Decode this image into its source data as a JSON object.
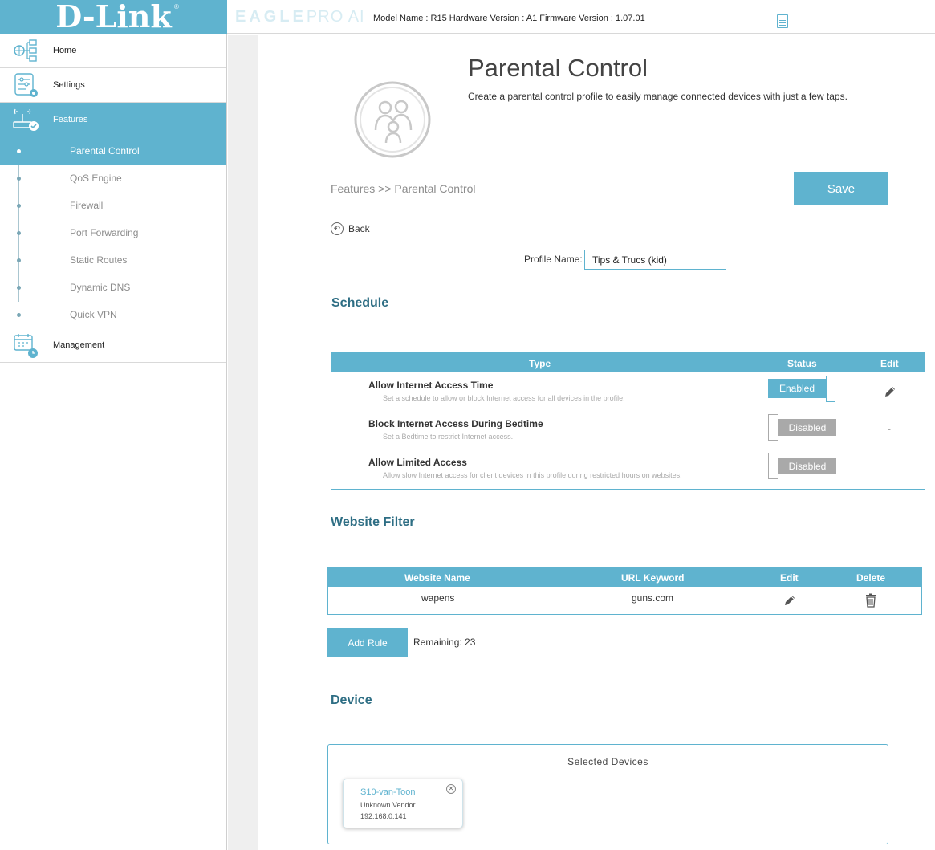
{
  "header": {
    "logo": "D-Link",
    "logo_mark": "®",
    "brand_bold": "EAGLE",
    "brand_light": "PRO AI",
    "model_info": "Model Name : R15 Hardware Version : A1 Firmware Version : 1.07.01",
    "icon": "document-icon"
  },
  "sidebar": {
    "home": "Home",
    "settings": "Settings",
    "features": "Features",
    "management": "Management",
    "sub_items": [
      "Parental Control",
      "QoS Engine",
      "Firewall",
      "Port Forwarding",
      "Static Routes",
      "Dynamic DNS",
      "Quick VPN"
    ]
  },
  "page": {
    "title": "Parental Control",
    "description": "Create a parental control profile to easily manage connected devices with just a few taps.",
    "breadcrumb": "Features >> Parental Control",
    "save": "Save",
    "back": "Back",
    "profile_label": "Profile Name:",
    "profile_value": "Tips & Trucs (kid)"
  },
  "schedule": {
    "heading": "Schedule",
    "col_type": "Type",
    "col_status": "Status",
    "col_edit": "Edit",
    "rows": [
      {
        "title": "Allow Internet Access Time",
        "desc": "Set a schedule to allow or block Internet access for all devices in the profile.",
        "status": "Enabled"
      },
      {
        "title": "Block Internet Access During Bedtime",
        "desc": "Set a Bedtime to restrict Internet access.",
        "status": "Disabled",
        "edit": "-"
      },
      {
        "title": "Allow Limited Access",
        "desc": "Allow slow Internet access for client devices in this profile during restricted hours on websites.",
        "status": "Disabled"
      }
    ]
  },
  "website_filter": {
    "heading": "Website Filter",
    "col_name": "Website Name",
    "col_keyword": "URL Keyword",
    "col_edit": "Edit",
    "col_delete": "Delete",
    "rows": [
      {
        "name": "wapens",
        "keyword": "guns.com"
      }
    ],
    "add_rule": "Add Rule",
    "remaining": "Remaining: 23"
  },
  "device": {
    "heading": "Device",
    "box_title": "Selected Devices",
    "card": {
      "name": "S10-van-Toon",
      "vendor": "Unknown Vendor",
      "ip": "192.168.0.141"
    }
  },
  "colors": {
    "accent": "#5fb3cf",
    "heading": "#2e6e84",
    "disabled": "#a9a9a9"
  }
}
